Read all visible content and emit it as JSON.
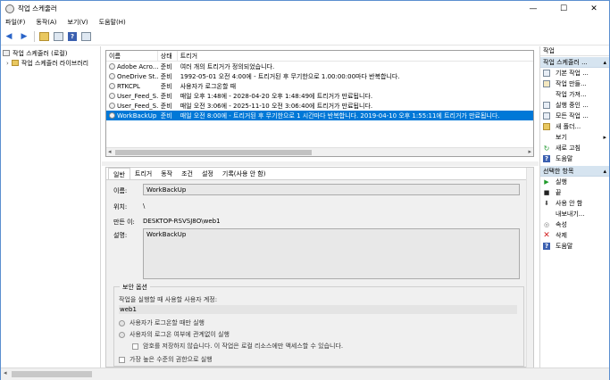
{
  "window": {
    "title": "작업 스케줄러",
    "minimize": "—",
    "maximize": "☐",
    "close": "✕"
  },
  "menu": [
    "파일(F)",
    "동작(A)",
    "보기(V)",
    "도움말(H)"
  ],
  "tree": [
    {
      "label": "작업 스케줄러 (로컬)"
    },
    {
      "label": "작업 스케줄러 라이브러리",
      "arrow": "›"
    }
  ],
  "list": {
    "headers": [
      "이름",
      "상태",
      "트리거"
    ],
    "rows": [
      {
        "name": "Adobe Acro...",
        "status": "준비",
        "trigger": "여러 개의 트리거가 정의되었습니다."
      },
      {
        "name": "OneDrive St...",
        "status": "준비",
        "trigger": "1992-05-01 오전 4:00에 - 트리거된 후 무기한으로 1.00:00:00마다 반복합니다."
      },
      {
        "name": "RTKCPL",
        "status": "준비",
        "trigger": "사용자가 로그온할 때"
      },
      {
        "name": "User_Feed_S...",
        "status": "준비",
        "trigger": "매일 오후 1:48에 - 2028-04-20 오후 1:48:49에 트리거가 만료됩니다."
      },
      {
        "name": "User_Feed_S...",
        "status": "준비",
        "trigger": "매일 오전 3:06에 - 2025-11-10 오전 3:06:40에 트리거가 만료됩니다."
      },
      {
        "name": "WorkBackUp",
        "status": "준비",
        "trigger": "매일 오전 8:00에 - 트리거된 후 무기한으로 1 시간마다 반복합니다. 2019-04-10 오후 1:55:11에 트리거가 만료됩니다.",
        "selected": true
      }
    ]
  },
  "tabs": [
    "일반",
    "트리거",
    "동작",
    "조건",
    "설정",
    "기록(사용 안 함)"
  ],
  "detail": {
    "name_label": "이름:",
    "name_value": "WorkBackUp",
    "location_label": "위치:",
    "location_value": "\\",
    "author_label": "만든 이:",
    "author_value": "DESKTOP-RSVSJ8O\\web1",
    "desc_label": "설명:",
    "desc_value": "WorkBackUp"
  },
  "security": {
    "title": "보안 옵션",
    "account_prompt": "작업을 실행할 때 사용할 사용자 계정:",
    "account": "web1",
    "opt_logged_on": "사용자가 로그온할 때만 실행",
    "opt_any": "사용자의 로그온 여부에 관계없이 실행",
    "opt_no_password": "암호를 저장하지 않습니다. 이 작업은 로컬 리소스에만 액세스할 수 있습니다.",
    "opt_highest": "가장 높은 수준의 권한으로 실행"
  },
  "actions": {
    "header": "작업",
    "section1": "작업 스케줄러 ...",
    "section1_items": [
      {
        "label": "기본 작업 ...",
        "icon": "basic-task-icon"
      },
      {
        "label": "작업 만들...",
        "icon": "create-task-icon"
      },
      {
        "label": "작업 가져...",
        "icon": "import-task-icon"
      },
      {
        "label": "실행 중인 ...",
        "icon": "running-tasks-icon"
      },
      {
        "label": "모든 작업 ...",
        "icon": "all-tasks-icon"
      },
      {
        "label": "새 폴더...",
        "icon": "new-folder-icon"
      },
      {
        "label": "보기",
        "icon": "view-icon",
        "arrow": "▸"
      },
      {
        "label": "새로 고침",
        "icon": "refresh-icon"
      },
      {
        "label": "도움말",
        "icon": "help-icon"
      }
    ],
    "section2": "선택한 항목",
    "section2_items": [
      {
        "label": "실행",
        "icon": "run-icon"
      },
      {
        "label": "끝",
        "icon": "end-icon"
      },
      {
        "label": "사용 안 함",
        "icon": "disable-icon"
      },
      {
        "label": "내보내기...",
        "icon": "export-icon"
      },
      {
        "label": "속성",
        "icon": "properties-icon"
      },
      {
        "label": "삭제",
        "icon": "delete-icon"
      },
      {
        "label": "도움말",
        "icon": "help-icon"
      }
    ],
    "collapse": "▴"
  },
  "colors": {
    "selection": "#0078d7",
    "section_bg": "#d6e4f0"
  }
}
